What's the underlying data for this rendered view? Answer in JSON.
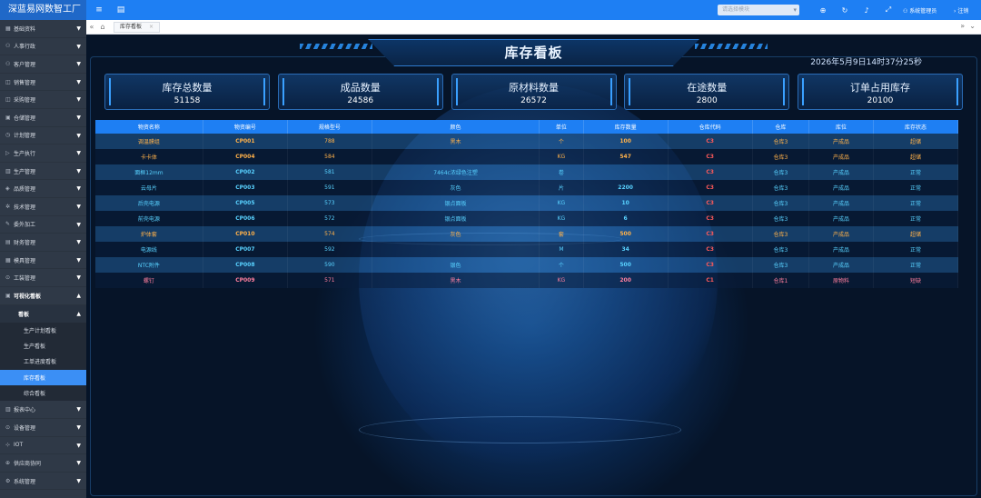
{
  "app": {
    "brand": "深蓝易网数智工厂"
  },
  "topbar": {
    "menu_icon": "menu-icon",
    "search_placeholder": "请选择模块",
    "user": "系统管理员",
    "logout": "注销"
  },
  "sidebar": {
    "items": [
      {
        "label": "基础资料"
      },
      {
        "label": "人事行政"
      },
      {
        "label": "客户管理"
      },
      {
        "label": "销售管理"
      },
      {
        "label": "采购管理"
      },
      {
        "label": "仓储管理"
      },
      {
        "label": "计划管理"
      },
      {
        "label": "生产执行"
      },
      {
        "label": "生产管理"
      },
      {
        "label": "品质管理"
      },
      {
        "label": "技术管理"
      },
      {
        "label": "委外加工"
      },
      {
        "label": "财务管理"
      },
      {
        "label": "模具管理"
      },
      {
        "label": "工装管理"
      },
      {
        "label": "可视化看板"
      }
    ],
    "sub_group": "看板",
    "leaves": [
      {
        "label": "生产计划看板"
      },
      {
        "label": "生产看板"
      },
      {
        "label": "工单进度看板"
      },
      {
        "label": "库存看板"
      },
      {
        "label": "综合看板"
      }
    ],
    "bottom_items": [
      {
        "label": "报表中心"
      },
      {
        "label": "设备管理"
      },
      {
        "label": "IOT"
      },
      {
        "label": "供应商协同"
      },
      {
        "label": "系统管理"
      }
    ]
  },
  "tabbar": {
    "active_tab": "库存看板"
  },
  "dashboard": {
    "title": "库存看板",
    "datetime": "2026年5月9日14时37分25秒",
    "stats": [
      {
        "label": "库存总数量",
        "value": "51158"
      },
      {
        "label": "成品数量",
        "value": "24586"
      },
      {
        "label": "原材料数量",
        "value": "26572"
      },
      {
        "label": "在途数量",
        "value": "2800"
      },
      {
        "label": "订单占用库存",
        "value": "20100"
      }
    ],
    "table": {
      "headers": [
        "物资名称",
        "物资编号",
        "规格型号",
        "颜色",
        "单位",
        "库存数量",
        "仓库代码",
        "仓库",
        "库位",
        "库存状态"
      ],
      "rows": [
        {
          "cells": [
            "调温膜组",
            "CP001",
            "788",
            "黑木",
            "个",
            "100",
            "C3",
            "仓库3",
            "产成品",
            "超储"
          ],
          "tone": "orange"
        },
        {
          "cells": [
            "卡卡体",
            "CP004",
            "584",
            "",
            "KG",
            "547",
            "C3",
            "仓库3",
            "产成品",
            "超储"
          ],
          "tone": "orange"
        },
        {
          "cells": [
            "面框12mm",
            "CP002",
            "581",
            "7464c浓绿色注塑",
            "卷",
            "",
            "C3",
            "仓库3",
            "产成品",
            "正常"
          ],
          "tone": "cyan"
        },
        {
          "cells": [
            "云母片",
            "CP003",
            "591",
            "灰色",
            "片",
            "2200",
            "C3",
            "仓库3",
            "产成品",
            "正常"
          ],
          "tone": "cyan"
        },
        {
          "cells": [
            "后壳电源",
            "CP005",
            "573",
            "银点面板",
            "KG",
            "10",
            "C3",
            "仓库3",
            "产成品",
            "正常"
          ],
          "tone": "cyan"
        },
        {
          "cells": [
            "前壳电源",
            "CP006",
            "572",
            "银点面板",
            "KG",
            "6",
            "C3",
            "仓库3",
            "产成品",
            "正常"
          ],
          "tone": "cyan"
        },
        {
          "cells": [
            "炉体套",
            "CP010",
            "574",
            "灰色",
            "套",
            "500",
            "C3",
            "仓库3",
            "产成品",
            "超储"
          ],
          "tone": "orange"
        },
        {
          "cells": [
            "电源线",
            "CP007",
            "592",
            "",
            "M",
            "34",
            "C3",
            "仓库3",
            "产成品",
            "正常"
          ],
          "tone": "cyan"
        },
        {
          "cells": [
            "NTC附件",
            "CP008",
            "590",
            "银色",
            "个",
            "500",
            "C3",
            "仓库3",
            "产成品",
            "正常"
          ],
          "tone": "cyan"
        },
        {
          "cells": [
            "螺钉",
            "CP009",
            "571",
            "黑木",
            "KG",
            "200",
            "C1",
            "仓库1",
            "原物料",
            "短缺"
          ],
          "tone": "pink"
        }
      ]
    }
  },
  "colors": {
    "primary": "#1e7ff3",
    "sidebar": "#2f3947",
    "active": "#3b8ff5",
    "orange": "#ffb14a",
    "cyan": "#59d2ff",
    "pink": "#ff7f9e",
    "code": "#ff5a5a"
  }
}
